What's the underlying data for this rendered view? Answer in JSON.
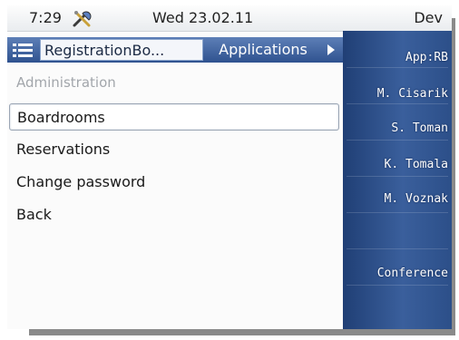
{
  "status_bar": {
    "time": "7:29",
    "date": "Wed 23.02.11",
    "device": "Dev",
    "tools_icon": "tools-icon"
  },
  "tabs": {
    "active": "RegistrationBo...",
    "other": "Applications"
  },
  "menu": {
    "title": "Administration",
    "items": [
      "Boardrooms",
      "Reservations",
      "Change password",
      "Back"
    ],
    "selected_index": 0
  },
  "sidebar": {
    "keys": [
      "App:RB",
      "M. Cisarik",
      "S. Toman",
      "K. Tomala",
      "M. Voznak",
      "",
      "Conference",
      ""
    ]
  },
  "colors": {
    "tab_bar": "#2f528f",
    "sidebar": "#2c4f89",
    "section_title": "#a2a6ab"
  }
}
